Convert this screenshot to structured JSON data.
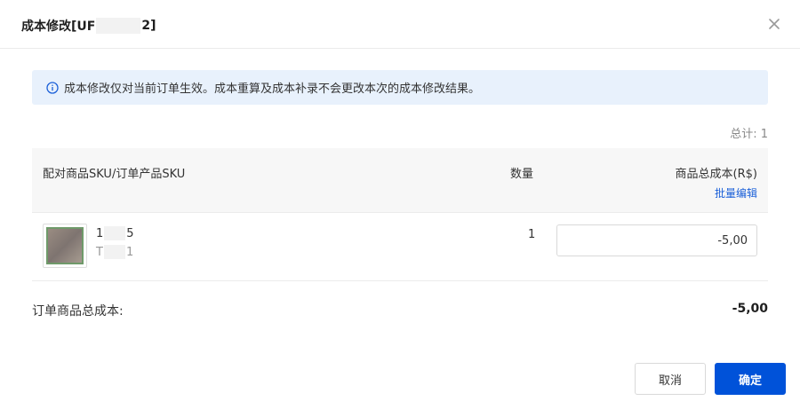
{
  "dialog": {
    "title_prefix": "成本修改[UF",
    "title_suffix": "2]",
    "close_icon": "close-icon"
  },
  "notice": {
    "icon": "info-icon",
    "text": "成本修改仅对当前订单生效。成本重算及成本补录不会更改本次的成本修改结果。",
    "bg_color": "#e8f1fc",
    "icon_color": "#1a5fd8"
  },
  "table": {
    "total_label": "总计: 1",
    "headers": {
      "sku": "配对商品SKU/订单产品SKU",
      "qty": "数量",
      "cost": "商品总成本(R$)",
      "bulk_edit": "批量编辑"
    },
    "rows": [
      {
        "sku_prefix": "1",
        "sku_suffix": "5",
        "name_prefix": "T",
        "name_suffix": "1",
        "qty": "1",
        "cost": "-5,00"
      }
    ]
  },
  "summary": {
    "label": "订单商品总成本:",
    "value": "-5,00"
  },
  "footer": {
    "cancel_label": "取消",
    "ok_label": "确定",
    "primary_color": "#0052d9"
  }
}
